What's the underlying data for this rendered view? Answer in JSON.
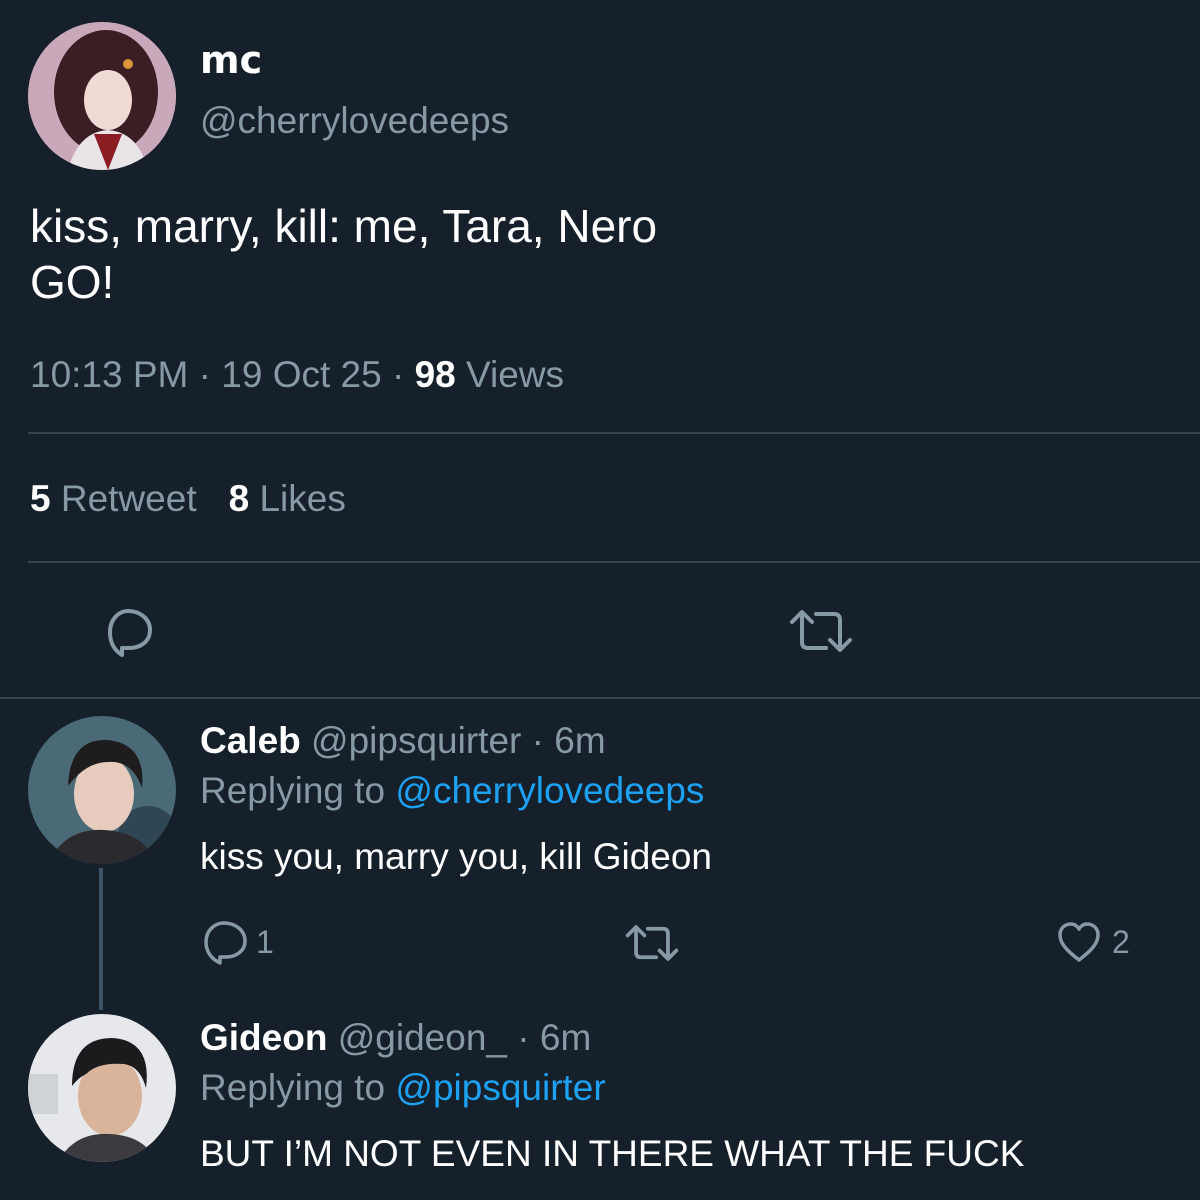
{
  "tweet": {
    "display_name": "mc",
    "handle": "@cherrylovedeeps",
    "text": "kiss, marry, kill: me, Tara, Nero\nGO!",
    "time": "10:13 PM",
    "separator": "·",
    "date": "19 Oct 25",
    "views_count": "98",
    "views_label": "Views",
    "retweet_count": "5",
    "retweet_label": "Retweet",
    "likes_count": "8",
    "likes_label": "Likes",
    "actions": {
      "reply_icon": "reply-bubble-icon",
      "retweet_icon": "retweet-icon"
    }
  },
  "replies": [
    {
      "name": "Caleb",
      "handle": "@pipsquirter",
      "time": "· 6m",
      "replying_prefix": "Replying to",
      "replying_to": "@cherrylovedeeps",
      "text": "kiss you, marry you, kill Gideon",
      "reply_count": "1",
      "like_count": "2"
    },
    {
      "name": "Gideon",
      "handle": "@gideon_",
      "time": "· 6m",
      "replying_prefix": "Replying to",
      "replying_to": "@pipsquirter",
      "text": "BUT I’M NOT EVEN IN THERE WHAT THE FUCK"
    }
  ],
  "colors": {
    "background": "#15202b",
    "secondary_text": "#8899a6",
    "link": "#1da1f2",
    "divider": "#38444d"
  }
}
